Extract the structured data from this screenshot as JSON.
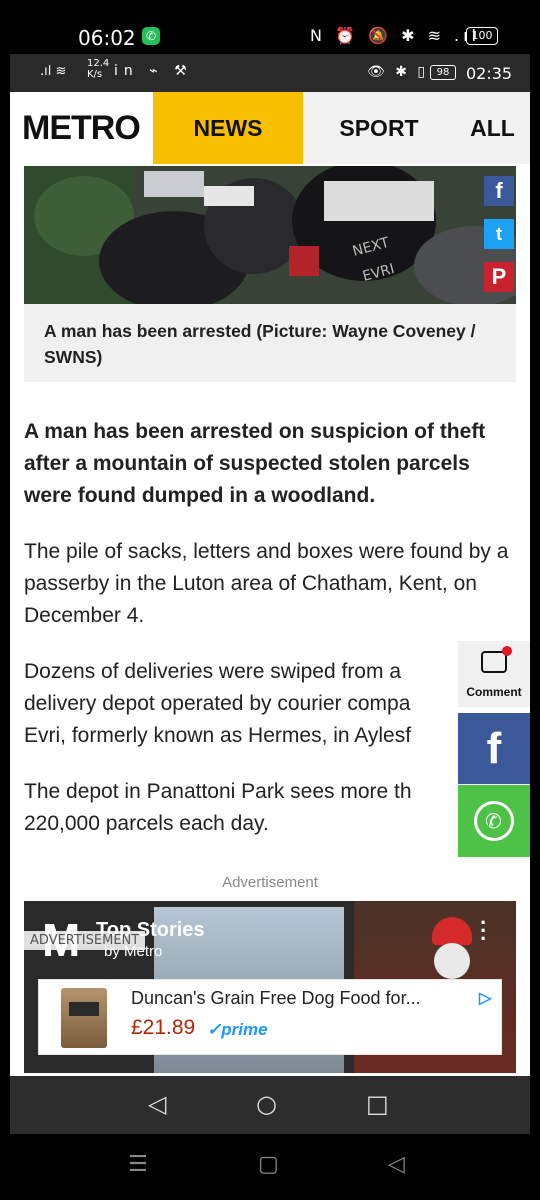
{
  "outer_status": {
    "time": "06:02",
    "icons": "N ⏰ 🔕 ✱ ≋ .ıl",
    "battery": "100"
  },
  "inner_status": {
    "signal": ".ıl ≋",
    "speed_value": "12.4",
    "speed_unit": "K/s",
    "left_icons": "in ⌁ ⚒",
    "right_icons": "👁 ✱ ▯",
    "battery": "98",
    "clock": "02:35"
  },
  "nav": {
    "logo": "METRO",
    "news": "NEWS",
    "sport": "SPORT",
    "all": "ALL"
  },
  "share": {
    "facebook": "f",
    "twitter": "t",
    "pinterest": "P"
  },
  "caption": "A man has been arrested (Picture: Wayne Coveney / SWNS)",
  "article": {
    "lead": "A man has been arrested on suspicion of theft after a mountain of suspected stolen parcels were found dumped in a woodland.",
    "p1": "The pile of sacks, letters and boxes were found by a passerby in the Luton area of Chatham, Kent, on December 4.",
    "p2_l1": "Dozens of deliveries were swiped from a",
    "p2_l2": "delivery depot operated by courier compa",
    "p2_l3": "Evri, formerly known as Hermes, in Aylesf",
    "p3_l1": "The depot in Panattoni Park sees more th",
    "p3_l2": "220,000 parcels each day.",
    "advertisement": "Advertisement"
  },
  "float": {
    "comment_label": "Comment",
    "facebook": "f",
    "whatsapp": "✆"
  },
  "stories": {
    "logo": "M",
    "title": "Top Stories",
    "by": "by Metro"
  },
  "ad": {
    "badge": "ADVERTISEMENT",
    "title": "Duncan's Grain Free Dog Food for...",
    "price": "£21.89",
    "prime": "✓prime",
    "choices": "▷"
  },
  "inner_nav": {
    "back": "◁",
    "home": "○",
    "recent": "□"
  },
  "outer_nav": {
    "menu": "☰",
    "home": "▢",
    "back": "◁"
  },
  "colors": {
    "news_tab": "#f7bf00",
    "facebook": "#3b5998",
    "whatsapp": "#4dc247",
    "pinterest": "#c8232c",
    "twitter": "#1da1f2"
  }
}
